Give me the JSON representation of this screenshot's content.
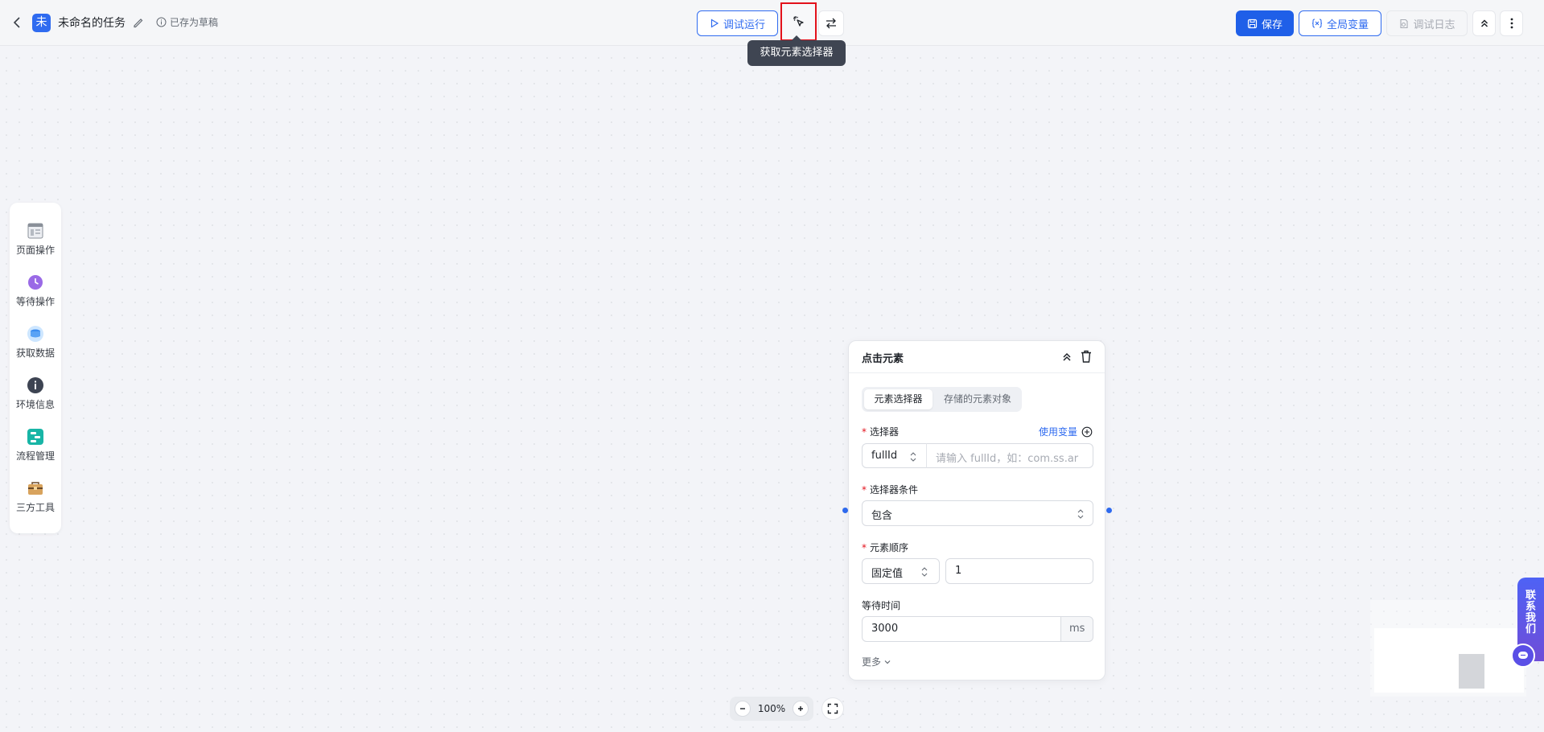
{
  "header": {
    "logo_char": "未",
    "task_title": "未命名的任务",
    "draft_status": "已存为草稿",
    "debug_run_label": "调试运行",
    "picker_tooltip": "获取元素选择器",
    "save_label": "保存",
    "global_var_label": "全局变量",
    "debug_log_label": "调试日志"
  },
  "toolbox": {
    "items": [
      {
        "label": "页面操作",
        "icon": "page-icon"
      },
      {
        "label": "等待操作",
        "icon": "clock-icon"
      },
      {
        "label": "获取数据",
        "icon": "database-icon"
      },
      {
        "label": "环境信息",
        "icon": "info-icon"
      },
      {
        "label": "流程管理",
        "icon": "flow-icon"
      },
      {
        "label": "三方工具",
        "icon": "toolbox-icon"
      }
    ]
  },
  "node": {
    "title": "点击元素",
    "tabs": [
      "元素选择器",
      "存储的元素对象"
    ],
    "selector_label": "选择器",
    "use_var_label": "使用变量",
    "selector_type": "fullId",
    "selector_placeholder": "请输入 fullId，如：com.ss.ar",
    "condition_label": "选择器条件",
    "condition_value": "包含",
    "order_label": "元素顺序",
    "order_type": "固定值",
    "order_value": "1",
    "wait_label": "等待时间",
    "wait_value": "3000",
    "wait_unit": "ms",
    "more_label": "更多"
  },
  "zoom": {
    "level": "100%"
  },
  "contact": {
    "label": "联系我们"
  },
  "colors": {
    "primary": "#2f6bf0",
    "save": "#1f5fe8",
    "highlight": "#e3111b",
    "contact": "#5a4fe6"
  }
}
